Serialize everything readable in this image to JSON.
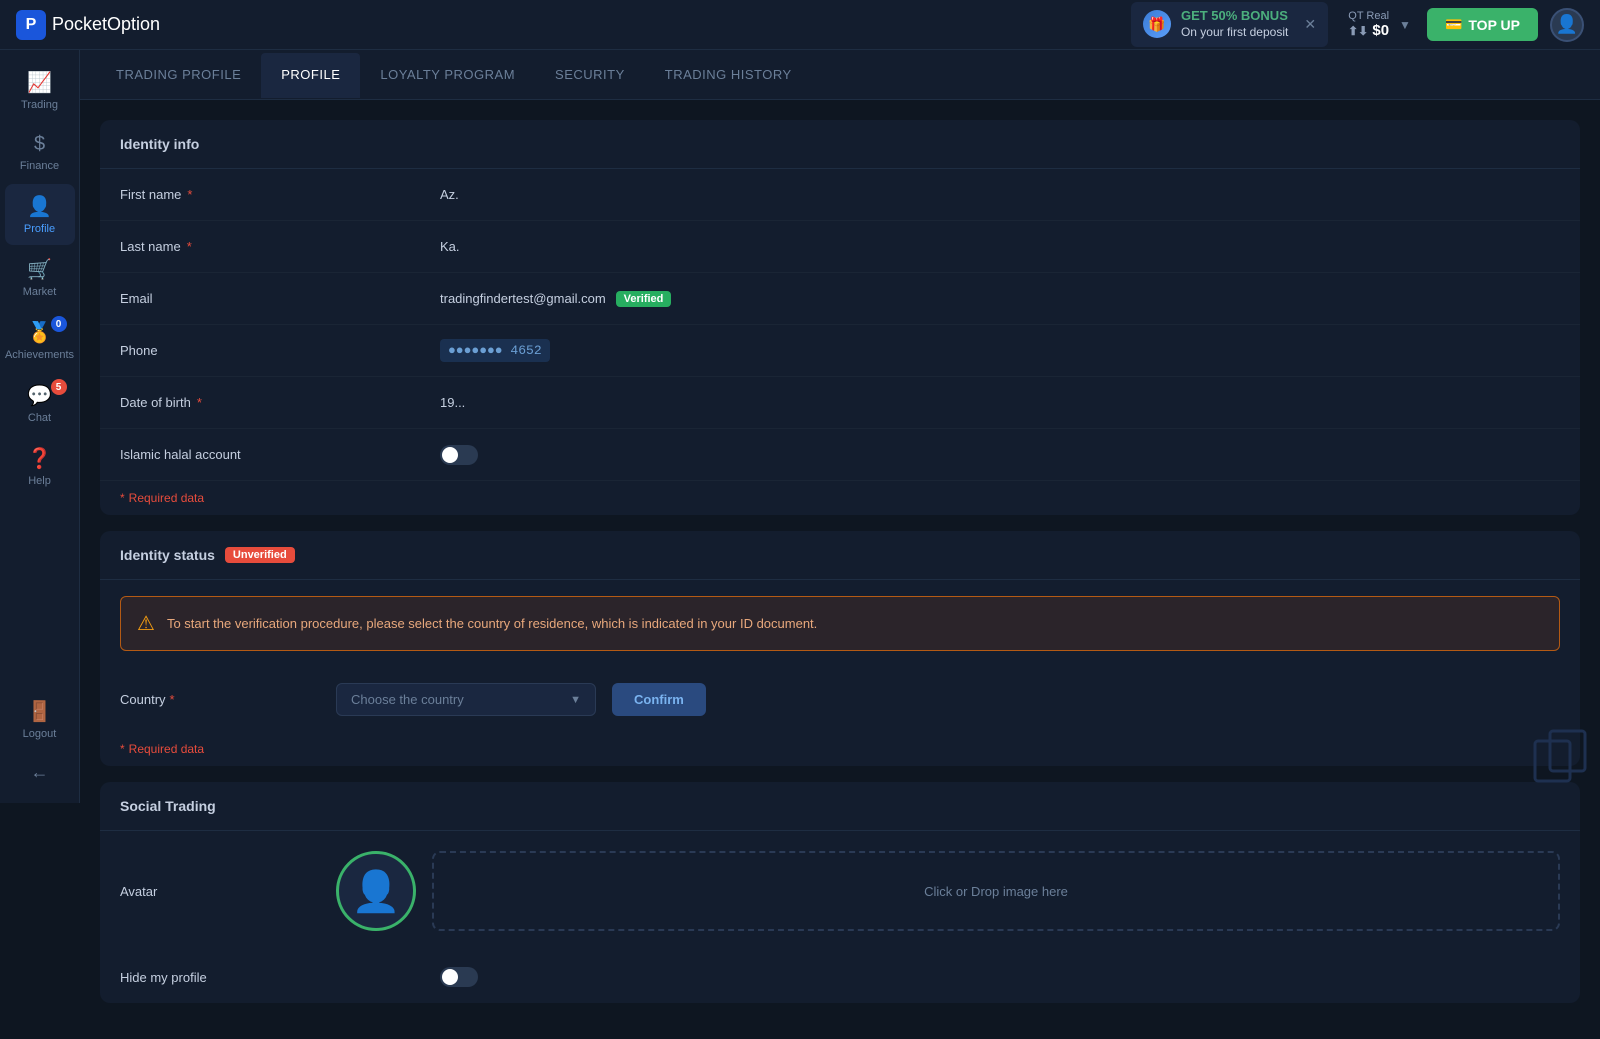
{
  "app": {
    "name": "Pocket",
    "name_bold": "Option"
  },
  "topbar": {
    "bonus_label": "GET 50% BONUS",
    "bonus_sub": "On your first deposit",
    "balance_label": "QT Real",
    "balance_amount": "$0",
    "topup_label": "TOP UP"
  },
  "sidebar": {
    "items": [
      {
        "id": "trading",
        "label": "Trading",
        "icon": "📈",
        "badge": null,
        "active": false
      },
      {
        "id": "finance",
        "label": "Finance",
        "icon": "💲",
        "badge": null,
        "active": false
      },
      {
        "id": "profile",
        "label": "Profile",
        "icon": "👤",
        "badge": null,
        "active": true
      },
      {
        "id": "market",
        "label": "Market",
        "icon": "🛒",
        "badge": null,
        "active": false
      },
      {
        "id": "achievements",
        "label": "Achievements",
        "icon": "🏅",
        "badge": "0",
        "active": false
      },
      {
        "id": "chat",
        "label": "Chat",
        "icon": "💬",
        "badge": "5",
        "active": false
      },
      {
        "id": "help",
        "label": "Help",
        "icon": "❓",
        "badge": null,
        "active": false
      },
      {
        "id": "logout",
        "label": "Logout",
        "icon": "🚪",
        "badge": null,
        "active": false
      }
    ]
  },
  "tabs": [
    {
      "id": "trading-profile",
      "label": "TRADING PROFILE",
      "active": false
    },
    {
      "id": "profile",
      "label": "PROFILE",
      "active": true
    },
    {
      "id": "loyalty",
      "label": "LOYALTY PROGRAM",
      "active": false
    },
    {
      "id": "security",
      "label": "SECURITY",
      "active": false
    },
    {
      "id": "trading-history",
      "label": "TRADING HISTORY",
      "active": false
    }
  ],
  "identity_info": {
    "section_title": "Identity info",
    "fields": [
      {
        "label": "First name",
        "required": true,
        "value": "Az."
      },
      {
        "label": "Last name",
        "required": true,
        "value": "Ka."
      },
      {
        "label": "Email",
        "required": false,
        "value": "tradingfindertest@gmail.com",
        "badge": "Verified"
      },
      {
        "label": "Phone",
        "required": false,
        "value": "4652",
        "prefix": "●●●●●●●"
      },
      {
        "label": "Date of birth",
        "required": true,
        "value": "19..."
      },
      {
        "label": "Islamic halal account",
        "required": false,
        "value": null,
        "toggle": true,
        "toggle_on": false
      }
    ],
    "required_note": "* Required data"
  },
  "identity_status": {
    "section_title": "Identity status",
    "badge": "Unverified",
    "warning": "To start the verification procedure, please select the country of residence, which is indicated in your ID document.",
    "country_label": "Country",
    "country_required": true,
    "country_placeholder": "Choose the country",
    "confirm_label": "Confirm",
    "required_note": "* Required data"
  },
  "social_trading": {
    "section_title": "Social Trading",
    "avatar_label": "Avatar",
    "drop_label": "Click or Drop image here",
    "hide_label": "Hide my profile",
    "hide_toggle_on": false
  }
}
